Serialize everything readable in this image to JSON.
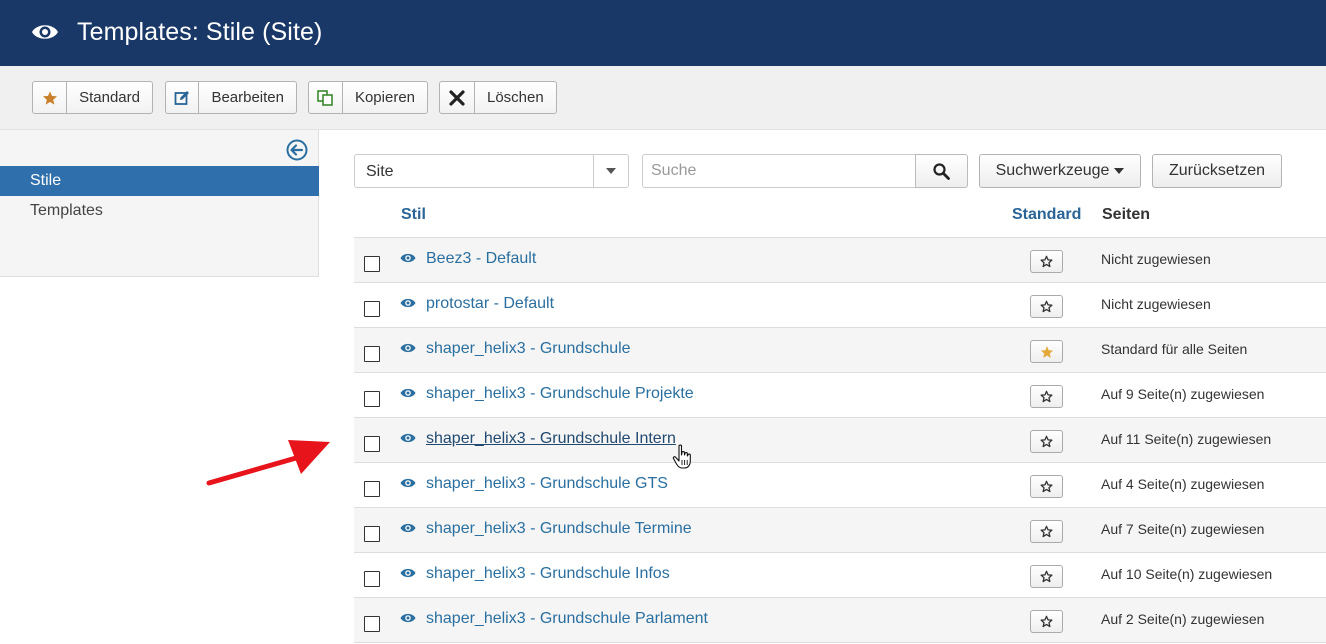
{
  "header": {
    "title": "Templates: Stile (Site)",
    "icon": "eye-icon",
    "color": "#1a3867"
  },
  "toolbar": [
    {
      "label": "Standard",
      "icon": "star-icon"
    },
    {
      "label": "Bearbeiten",
      "icon": "edit-icon"
    },
    {
      "label": "Kopieren",
      "icon": "copy-icon"
    },
    {
      "label": "Löschen",
      "icon": "close-icon"
    }
  ],
  "sidebar": {
    "items": [
      {
        "label": "Stile",
        "active": true
      },
      {
        "label": "Templates",
        "active": false
      }
    ]
  },
  "filters": {
    "client_select": "Site",
    "search_placeholder": "Suche",
    "search_tools_label": "Suchwerkzeuge",
    "reset_label": "Zurücksetzen"
  },
  "table": {
    "headers": {
      "style": "Stil",
      "default": "Standard",
      "pages": "Seiten"
    },
    "rows": [
      {
        "name": "Beez3 - Default",
        "default": false,
        "pages": "Nicht zugewiesen"
      },
      {
        "name": "protostar - Default",
        "default": false,
        "pages": "Nicht zugewiesen"
      },
      {
        "name": "shaper_helix3 - Grundschule",
        "default": true,
        "pages": "Standard für alle Seiten"
      },
      {
        "name": "shaper_helix3 - Grundschule Projekte",
        "default": false,
        "pages": "Auf 9 Seite(n) zugewiesen"
      },
      {
        "name": "shaper_helix3 - Grundschule Intern",
        "default": false,
        "pages": "Auf 11 Seite(n) zugewiesen",
        "hovered": true
      },
      {
        "name": "shaper_helix3 - Grundschule GTS",
        "default": false,
        "pages": "Auf 4 Seite(n) zugewiesen"
      },
      {
        "name": "shaper_helix3 - Grundschule Termine",
        "default": false,
        "pages": "Auf 7 Seite(n) zugewiesen"
      },
      {
        "name": "shaper_helix3 - Grundschule Infos",
        "default": false,
        "pages": "Auf 10 Seite(n) zugewiesen"
      },
      {
        "name": "shaper_helix3 - Grundschule Parlament",
        "default": false,
        "pages": "Auf 2 Seite(n) zugewiesen"
      }
    ]
  },
  "colors": {
    "link": "#2a6f9f",
    "accent": "#2f6fab",
    "star_default": "#e5a93a",
    "annotation_arrow": "#e8141b"
  }
}
